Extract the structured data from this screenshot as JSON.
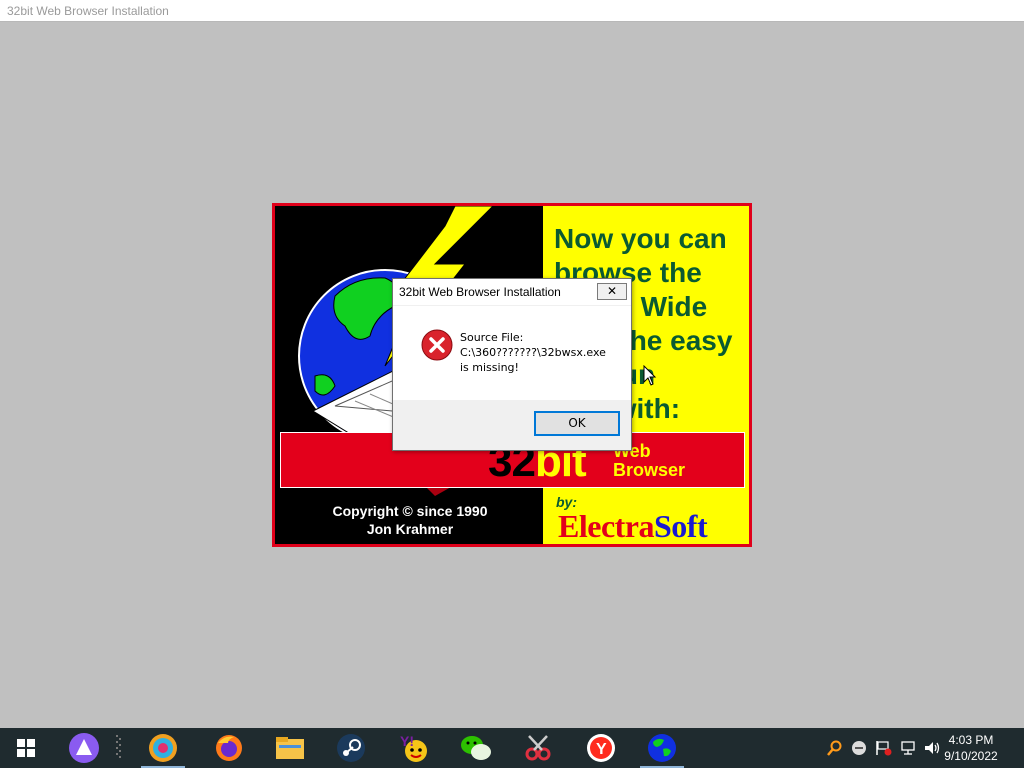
{
  "window": {
    "title": "32bit Web Browser Installation"
  },
  "splash": {
    "tagline_lines": [
      "Now you can",
      "browse the",
      "World Wide",
      "Web the easy",
      "and fun",
      "way with:"
    ],
    "product_number": "32",
    "product_bit": "bit",
    "product_sub_1": "Web",
    "product_sub_2": "Browser",
    "copyright_line1": "Copyright © since 1990",
    "copyright_line2": "Jon Krahmer",
    "by_label": "by:",
    "brand_1": "Electra",
    "brand_2": "Soft"
  },
  "dialog": {
    "title": "32bit Web Browser Installation",
    "close_label": "✕",
    "message_line1": "Source File:",
    "message_line2": "C:\\360???????\\32bwsx.exe",
    "message_line3": "is missing!",
    "ok_label": "OK"
  },
  "taskbar": {
    "items": [
      "start-icon",
      "cortana-icon",
      "app-icon",
      "firefox-icon",
      "file-explorer-icon",
      "steam-icon",
      "yahoo-messenger-icon",
      "wechat-icon",
      "scissors-app-icon",
      "yandex-browser-icon",
      "globe-browser-icon"
    ],
    "clock_time": "4:03 PM",
    "clock_date": "9/10/2022"
  },
  "colors": {
    "splash_border": "#e0001a",
    "splash_yellow": "#ffff00",
    "tagline_green": "#0a5a32",
    "band_red": "#e3001b",
    "taskbar_bg": "#1f2b2f"
  }
}
